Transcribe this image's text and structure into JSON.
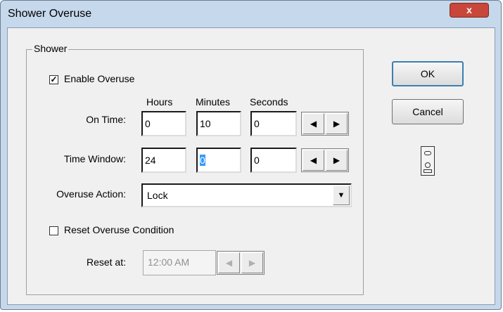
{
  "window": {
    "title": "Shower Overuse",
    "close_glyph": "x"
  },
  "group": {
    "label": "Shower"
  },
  "enable_overuse": {
    "label": "Enable Overuse",
    "checked": true,
    "check_glyph": "✓"
  },
  "columns": {
    "hours": "Hours",
    "minutes": "Minutes",
    "seconds": "Seconds"
  },
  "on_time": {
    "label": "On Time:",
    "hours": "0",
    "minutes": "10",
    "seconds": "0"
  },
  "time_window": {
    "label": "Time Window:",
    "hours": "24",
    "minutes": "0",
    "seconds": "0"
  },
  "spinner": {
    "left_glyph": "◀",
    "right_glyph": "▶"
  },
  "overuse_action": {
    "label": "Overuse Action:",
    "value": "Lock",
    "arrow_glyph": "▼"
  },
  "reset_condition": {
    "label": "Reset Overuse Condition",
    "checked": false
  },
  "reset_at": {
    "label": "Reset at:",
    "value": "12:00 AM"
  },
  "buttons": {
    "ok": "OK",
    "cancel": "Cancel"
  },
  "icons": {
    "status": "lock-indicator-icon"
  }
}
